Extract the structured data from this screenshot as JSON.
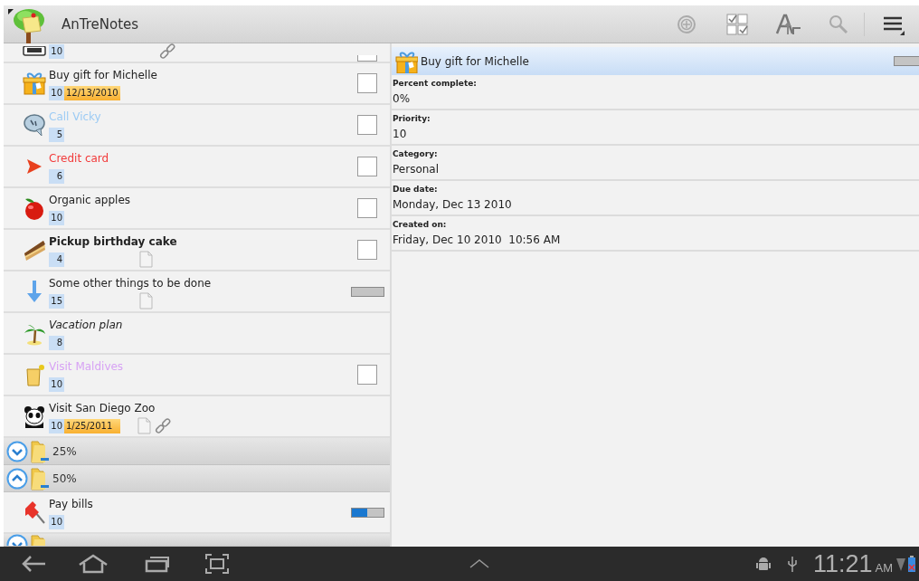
{
  "action_bar": {
    "title": "AnTreNotes"
  },
  "list": [
    {
      "kind": "partial",
      "priority": "10",
      "link": true,
      "checked": false
    },
    {
      "kind": "task",
      "title": "Buy gift for Michelle",
      "bold": false,
      "italic": false,
      "priority": "10",
      "due": "12/13/2010",
      "checked": false
    },
    {
      "kind": "task",
      "title": "Call Vicky",
      "bold": false,
      "italic": false,
      "color": "#9ccbf4",
      "priority": "5",
      "checked": false
    },
    {
      "kind": "task",
      "title": "Credit card",
      "bold": false,
      "italic": false,
      "color": "#f23a3a",
      "priority": "6",
      "checked": false
    },
    {
      "kind": "task",
      "title": "Organic apples",
      "bold": false,
      "italic": false,
      "priority": "10",
      "checked": false
    },
    {
      "kind": "task",
      "title": "Pickup birthday cake",
      "bold": true,
      "italic": false,
      "priority": "4",
      "note": true,
      "checked": false
    },
    {
      "kind": "task",
      "title": "Some other things to be done",
      "bold": false,
      "italic": false,
      "priority": "15",
      "note": true,
      "level": 0
    },
    {
      "kind": "task",
      "title": "Vacation plan",
      "bold": false,
      "italic": true,
      "priority": "8"
    },
    {
      "kind": "task",
      "title": "Visit Maldives",
      "bold": false,
      "italic": false,
      "color": "#d7a2f4",
      "priority": "10",
      "checked": false
    },
    {
      "kind": "task",
      "title": "Visit San Diego Zoo",
      "bold": false,
      "italic": false,
      "priority": "10",
      "due": "1/25/2011",
      "note": true,
      "link": true
    },
    {
      "kind": "group",
      "label": "25%",
      "expanded": false
    },
    {
      "kind": "group",
      "label": "50%",
      "expanded": true
    },
    {
      "kind": "task",
      "title": "Pay bills",
      "bold": false,
      "italic": false,
      "priority": "10",
      "level": 0.5
    },
    {
      "kind": "group",
      "expanded": false
    }
  ],
  "detail": {
    "title": "Buy gift for Michelle",
    "level": 0,
    "fields": [
      {
        "label": "Percent complete:",
        "value": "0%"
      },
      {
        "label": "Priority:",
        "value": "10"
      },
      {
        "label": "Category:",
        "value": "Personal"
      },
      {
        "label": "Due date:",
        "value": "Monday, Dec 13 2010"
      },
      {
        "label": "Created on:",
        "value": "Friday, Dec 10 2010  10:56 AM"
      }
    ]
  },
  "system_bar": {
    "time": "11:21",
    "ampm": "AM"
  }
}
